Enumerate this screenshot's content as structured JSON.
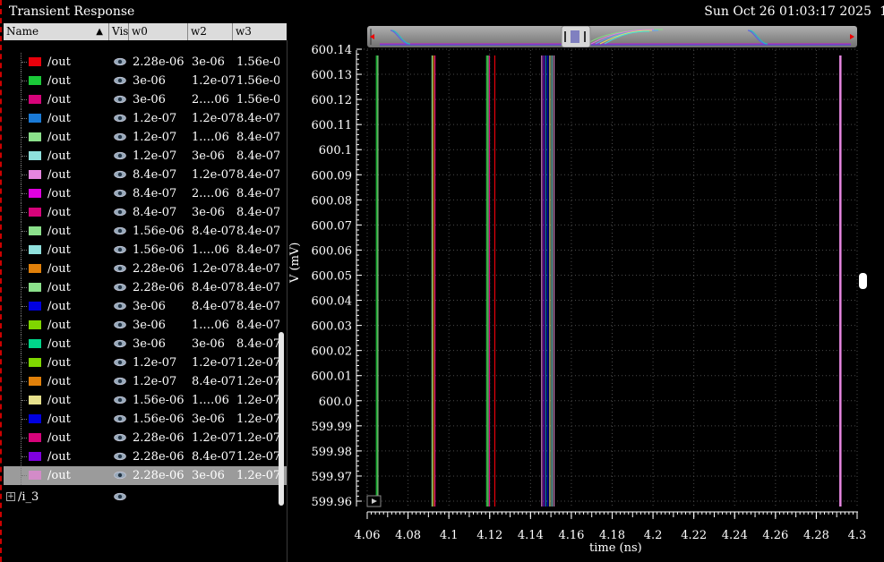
{
  "window": {
    "title": "Transient Response",
    "datetime": "Sun Oct 26 01:03:17 2025",
    "edge_char": "1"
  },
  "table": {
    "columns": [
      "Name",
      "Vis",
      "w0",
      "w2",
      "w3"
    ],
    "rows": [
      {
        "name": "/out",
        "color": "#e8000b",
        "w0": "2.28e-06",
        "w2": "3e-06",
        "w3": "1.56e-06"
      },
      {
        "name": "/out",
        "color": "#1ac938",
        "w0": "3e-06",
        "w2": "1.2e-07",
        "w3": "1.56e-06"
      },
      {
        "name": "/out",
        "color": "#d6037a",
        "w0": "3e-06",
        "w2": "2.…06",
        "w3": "1.56e-06"
      },
      {
        "name": "/out",
        "color": "#1a7ad6",
        "w0": "1.2e-07",
        "w2": "1.2e-07",
        "w3": "8.4e-07"
      },
      {
        "name": "/out",
        "color": "#8be08b",
        "w0": "1.2e-07",
        "w2": "1.…06",
        "w3": "8.4e-07"
      },
      {
        "name": "/out",
        "color": "#8fe0dc",
        "w0": "1.2e-07",
        "w2": "3e-06",
        "w3": "8.4e-07"
      },
      {
        "name": "/out",
        "color": "#e686e0",
        "w0": "8.4e-07",
        "w2": "1.2e-07",
        "w3": "8.4e-07"
      },
      {
        "name": "/out",
        "color": "#e000e0",
        "w0": "8.4e-07",
        "w2": "2.…06",
        "w3": "8.4e-07"
      },
      {
        "name": "/out",
        "color": "#d6037a",
        "w0": "8.4e-07",
        "w2": "3e-06",
        "w3": "8.4e-07"
      },
      {
        "name": "/out",
        "color": "#8be08b",
        "w0": "1.56e-06",
        "w2": "8.4e-07",
        "w3": "8.4e-07"
      },
      {
        "name": "/out",
        "color": "#8fe0dc",
        "w0": "1.56e-06",
        "w2": "1.…06",
        "w3": "8.4e-07"
      },
      {
        "name": "/out",
        "color": "#e0800a",
        "w0": "2.28e-06",
        "w2": "1.2e-07",
        "w3": "8.4e-07"
      },
      {
        "name": "/out",
        "color": "#8be08b",
        "w0": "2.28e-06",
        "w2": "8.4e-07",
        "w3": "8.4e-07"
      },
      {
        "name": "/out",
        "color": "#0000e0",
        "w0": "3e-06",
        "w2": "8.4e-07",
        "w3": "8.4e-07"
      },
      {
        "name": "/out",
        "color": "#7fd600",
        "w0": "3e-06",
        "w2": "1.…06",
        "w3": "8.4e-07"
      },
      {
        "name": "/out",
        "color": "#00d68a",
        "w0": "3e-06",
        "w2": "3e-06",
        "w3": "8.4e-07"
      },
      {
        "name": "/out",
        "color": "#7fd600",
        "w0": "1.2e-07",
        "w2": "1.2e-07",
        "w3": "1.2e-07"
      },
      {
        "name": "/out",
        "color": "#e0800a",
        "w0": "1.2e-07",
        "w2": "8.4e-07",
        "w3": "1.2e-07"
      },
      {
        "name": "/out",
        "color": "#e6e08b",
        "w0": "1.56e-06",
        "w2": "1.…06",
        "w3": "1.2e-07"
      },
      {
        "name": "/out",
        "color": "#0000e0",
        "w0": "1.56e-06",
        "w2": "3e-06",
        "w3": "1.2e-07"
      },
      {
        "name": "/out",
        "color": "#d6037a",
        "w0": "2.28e-06",
        "w2": "1.2e-07",
        "w3": "1.2e-07"
      },
      {
        "name": "/out",
        "color": "#7f00e0",
        "w0": "2.28e-06",
        "w2": "8.4e-07",
        "w3": "1.2e-07"
      },
      {
        "name": "/out",
        "color": "#d38bc8",
        "w0": "2.28e-06",
        "w2": "3e-06",
        "w3": "1.2e-07",
        "selected": true
      }
    ],
    "group_node": "/i_3"
  },
  "chart_data": {
    "type": "line",
    "xlabel": "time (ns)",
    "ylabel": "V (mV)",
    "xlim": [
      4.06,
      4.3
    ],
    "ylim": [
      599.96,
      600.14
    ],
    "x_ticks": [
      "4.06",
      "4.08",
      "4.1",
      "4.12",
      "4.14",
      "4.16",
      "4.18",
      "4.2",
      "4.22",
      "4.24",
      "4.26",
      "4.28",
      "4.3"
    ],
    "y_ticks": [
      "599.96",
      "599.97",
      "599.98",
      "599.99",
      "600.0",
      "600.01",
      "600.02",
      "600.03",
      "600.04",
      "600.05",
      "600.06",
      "600.07",
      "600.08",
      "600.09",
      "600.1",
      "600.11",
      "600.12",
      "600.13",
      "600.14"
    ],
    "grid": true,
    "transitions": [
      {
        "x": 4.0645,
        "color": "#1ac938"
      },
      {
        "x": 4.0652,
        "color": "#8be08b"
      },
      {
        "x": 4.0918,
        "color": "#8be08b"
      },
      {
        "x": 4.0925,
        "color": "#e0800a"
      },
      {
        "x": 4.0932,
        "color": "#d6037a"
      },
      {
        "x": 4.1185,
        "color": "#1ac938"
      },
      {
        "x": 4.1192,
        "color": "#8be08b"
      },
      {
        "x": 4.1199,
        "color": "#d6037a"
      },
      {
        "x": 4.1225,
        "color": "#e8000b"
      },
      {
        "x": 4.1455,
        "color": "#e686e0"
      },
      {
        "x": 4.1465,
        "color": "#7f00e0"
      },
      {
        "x": 4.1475,
        "color": "#1a7ad6"
      },
      {
        "x": 4.1485,
        "color": "#0000e0"
      },
      {
        "x": 4.1495,
        "color": "#e6e08b"
      },
      {
        "x": 4.1505,
        "color": "#8fe0dc"
      },
      {
        "x": 4.1515,
        "color": "#d38bc8"
      },
      {
        "x": 4.2918,
        "color": "#e686e0"
      }
    ]
  }
}
